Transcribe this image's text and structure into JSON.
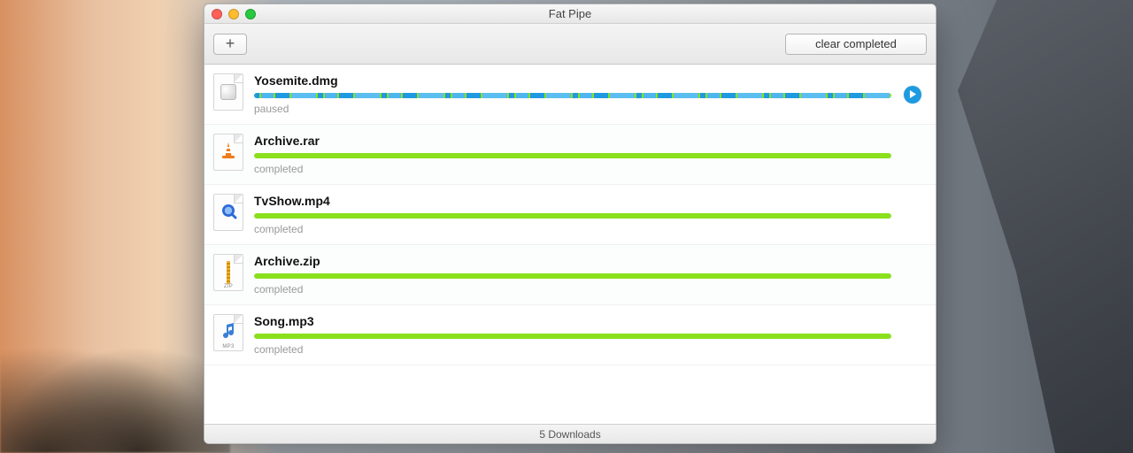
{
  "window": {
    "title": "Fat Pipe"
  },
  "toolbar": {
    "add_label": "+",
    "clear_completed_label": "clear completed"
  },
  "downloads": [
    {
      "filename": "Yosemite.dmg",
      "status": "paused",
      "icon": "dmg",
      "ext_tag": "",
      "has_resume": true
    },
    {
      "filename": "Archive.rar",
      "status": "completed",
      "icon": "cone",
      "ext_tag": "",
      "has_resume": false
    },
    {
      "filename": "TvShow.mp4",
      "status": "completed",
      "icon": "qt",
      "ext_tag": "",
      "has_resume": false
    },
    {
      "filename": "Archive.zip",
      "status": "completed",
      "icon": "zip",
      "ext_tag": "ZIP",
      "has_resume": false
    },
    {
      "filename": "Song.mp3",
      "status": "completed",
      "icon": "note",
      "ext_tag": "MP3",
      "has_resume": false
    }
  ],
  "statusbar": {
    "text": "5 Downloads"
  }
}
